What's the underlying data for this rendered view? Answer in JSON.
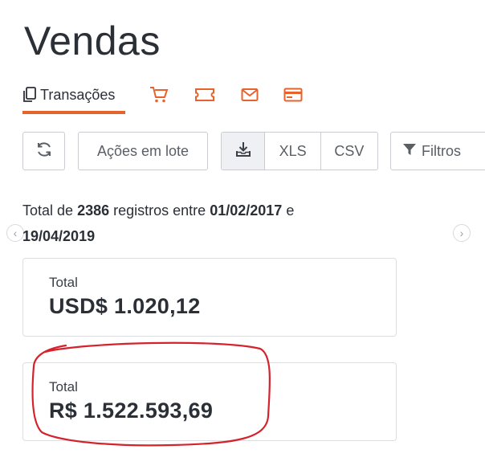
{
  "page": {
    "title": "Vendas"
  },
  "tabs": {
    "active_label": "Transações",
    "icons": [
      "copy-icon",
      "cart-icon",
      "ticket-icon",
      "mail-icon",
      "credit-card-icon"
    ],
    "accent_color": "#e8632b"
  },
  "toolbar": {
    "batch_label": "Ações em lote",
    "xls_label": "XLS",
    "csv_label": "CSV",
    "filter_label": "Filtros"
  },
  "summary": {
    "prefix": "Total de",
    "count": "2386",
    "middle": "registros entre",
    "start_date": "01/02/2017",
    "conj": "e",
    "end_date": "19/04/2019"
  },
  "cards": {
    "usd": {
      "label": "Total",
      "value": "USD$ 1.020,12"
    },
    "brl": {
      "label": "Total",
      "value": "R$ 1.522.593,69"
    }
  },
  "annotation": {
    "ring_color": "#d4232d"
  }
}
